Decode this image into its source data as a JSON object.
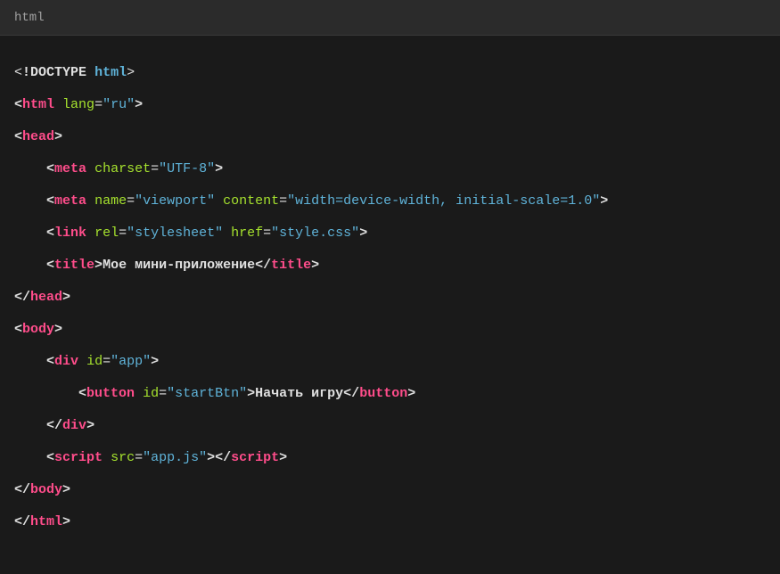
{
  "header": {
    "language": "html"
  },
  "code": {
    "doctype_excl": "!",
    "doctype_text": "DOCTYPE",
    "doctype_val": "html",
    "tags": {
      "html": "html",
      "head": "head",
      "meta": "meta",
      "link": "link",
      "title": "title",
      "body": "body",
      "div": "div",
      "button": "button",
      "script": "script"
    },
    "attrs": {
      "lang": "lang",
      "charset": "charset",
      "name": "name",
      "content": "content",
      "rel": "rel",
      "href": "href",
      "id": "id",
      "src": "src"
    },
    "values": {
      "lang": "\"ru\"",
      "charset": "\"UTF-8\"",
      "viewport": "\"viewport\"",
      "content_viewport": "\"width=device-width, initial-scale=1.0\"",
      "stylesheet": "\"stylesheet\"",
      "style_css": "\"style.css\"",
      "app": "\"app\"",
      "startBtn": "\"startBtn\"",
      "app_js": "\"app.js\""
    },
    "text": {
      "title": "Мое мини-приложение",
      "button": "Начать игру"
    },
    "punct": {
      "lt": "<",
      "gt": ">",
      "eq": "=",
      "slash": "/"
    }
  }
}
